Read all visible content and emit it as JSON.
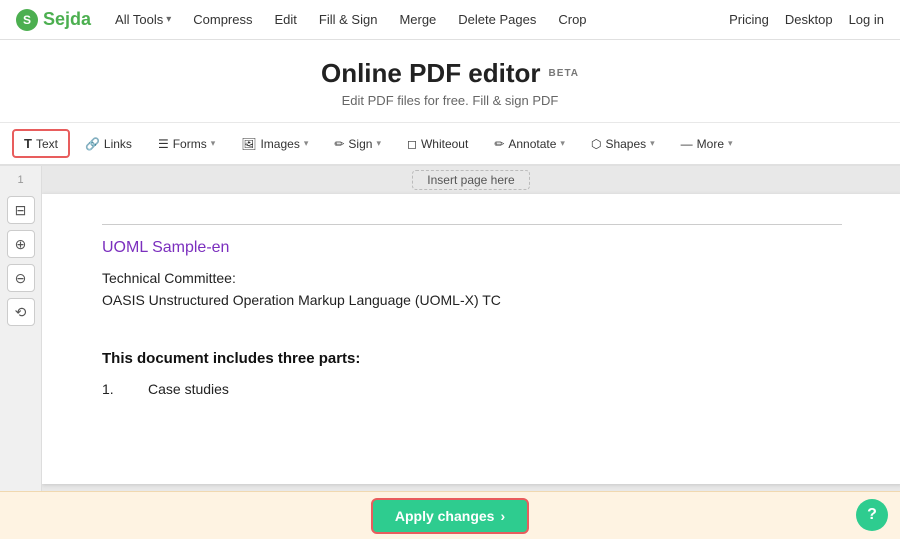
{
  "header": {
    "logo_letter": "S",
    "logo_name": "Sejda",
    "nav_items": [
      {
        "label": "All Tools",
        "has_chevron": true
      },
      {
        "label": "Compress",
        "has_chevron": false
      },
      {
        "label": "Edit",
        "has_chevron": false
      },
      {
        "label": "Fill & Sign",
        "has_chevron": false
      },
      {
        "label": "Merge",
        "has_chevron": false
      },
      {
        "label": "Delete Pages",
        "has_chevron": false
      },
      {
        "label": "Crop",
        "has_chevron": false
      }
    ],
    "right_items": [
      {
        "label": "Pricing"
      },
      {
        "label": "Desktop"
      },
      {
        "label": "Log in"
      }
    ]
  },
  "hero": {
    "title": "Online PDF editor",
    "beta": "BETA",
    "subtitle": "Edit PDF files for free. Fill & sign PDF"
  },
  "toolbar": {
    "items": [
      {
        "label": "Text",
        "icon": "T",
        "has_chevron": false,
        "active": true
      },
      {
        "label": "Links",
        "icon": "🔗",
        "has_chevron": false,
        "active": false
      },
      {
        "label": "Forms",
        "icon": "☰",
        "has_chevron": true,
        "active": false
      },
      {
        "label": "Images",
        "icon": "🖼",
        "has_chevron": true,
        "active": false
      },
      {
        "label": "Sign",
        "icon": "✏",
        "has_chevron": true,
        "active": false
      },
      {
        "label": "Whiteout",
        "icon": "◻",
        "has_chevron": false,
        "active": false
      },
      {
        "label": "Annotate",
        "icon": "✏",
        "has_chevron": true,
        "active": false
      },
      {
        "label": "Shapes",
        "icon": "⬡",
        "has_chevron": true,
        "active": false
      },
      {
        "label": "More",
        "icon": "—",
        "has_chevron": true,
        "active": false
      }
    ]
  },
  "side_tools": [
    {
      "icon": "⊟",
      "name": "fit-page"
    },
    {
      "icon": "⊕",
      "name": "zoom-in"
    },
    {
      "icon": "⊖",
      "name": "zoom-out"
    },
    {
      "icon": "⟲",
      "name": "rotate"
    }
  ],
  "page_number": "1",
  "insert_page_btn": "Insert page here",
  "pdf": {
    "title": "UOML Sample-en",
    "committee_label": "Technical Committee:",
    "committee_value": "OASIS Unstructured Operation Markup Language (UOML-X) TC",
    "section_heading": "This document includes three parts:",
    "list_items": [
      {
        "num": "1.",
        "label": "Case studies"
      }
    ]
  },
  "bottom": {
    "apply_label": "Apply changes",
    "apply_arrow": "›"
  },
  "help": "?"
}
